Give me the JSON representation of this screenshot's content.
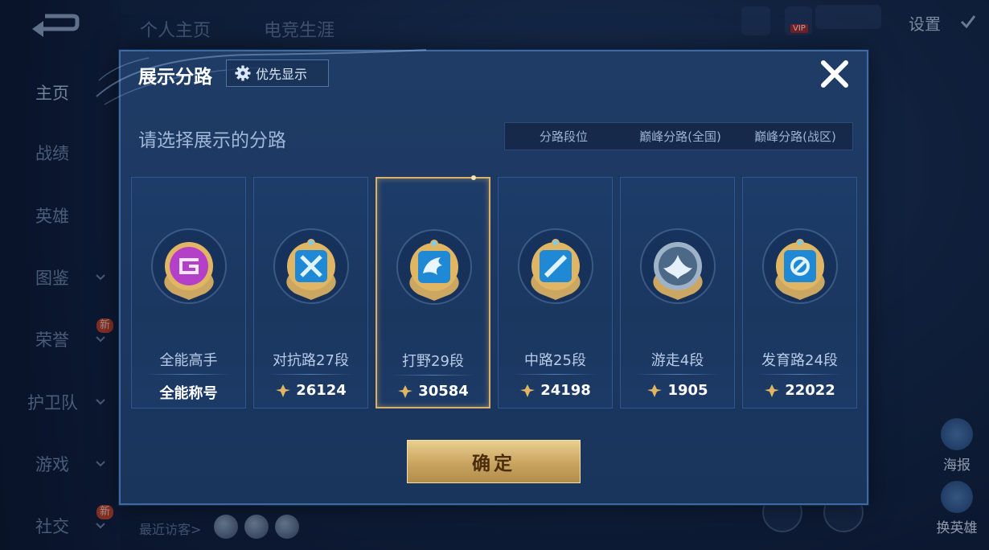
{
  "background": {
    "top_tabs": [
      "个人主页",
      "电竞生涯"
    ],
    "settings_label": "设置",
    "vip_label": "VIP",
    "sidebar": [
      {
        "label": "主页",
        "active": true,
        "chevron": false,
        "badge": ""
      },
      {
        "label": "战绩",
        "active": false,
        "chevron": false,
        "badge": ""
      },
      {
        "label": "英雄",
        "active": false,
        "chevron": false,
        "badge": ""
      },
      {
        "label": "图鉴",
        "active": false,
        "chevron": true,
        "badge": ""
      },
      {
        "label": "荣誉",
        "active": false,
        "chevron": true,
        "badge": "新"
      },
      {
        "label": "护卫队",
        "active": false,
        "chevron": true,
        "badge": ""
      },
      {
        "label": "游戏",
        "active": false,
        "chevron": true,
        "badge": ""
      },
      {
        "label": "社交",
        "active": false,
        "chevron": true,
        "badge": "新"
      }
    ],
    "recent_visitors_label": "最近访客>",
    "right_buttons": [
      "海报",
      "换英雄"
    ]
  },
  "modal": {
    "title": "展示分路",
    "priority_button": "优先显示",
    "subtitle": "请选择展示的分路",
    "segments": [
      {
        "label": "分路段位",
        "active": true
      },
      {
        "label": "巅峰分路(全国)",
        "active": false
      },
      {
        "label": "巅峰分路(战区)",
        "active": false
      }
    ],
    "cards": [
      {
        "name": "全能高手",
        "score": "全能称号",
        "has_score_icon": false,
        "emblem": "allround-emblem-icon",
        "selected": false
      },
      {
        "name": "对抗路27段",
        "score": "26124",
        "has_score_icon": true,
        "emblem": "clash-lane-emblem-icon",
        "selected": false
      },
      {
        "name": "打野29段",
        "score": "30584",
        "has_score_icon": true,
        "emblem": "jungle-emblem-icon",
        "selected": true
      },
      {
        "name": "中路25段",
        "score": "24198",
        "has_score_icon": true,
        "emblem": "mid-lane-emblem-icon",
        "selected": false
      },
      {
        "name": "游走4段",
        "score": "1905",
        "has_score_icon": true,
        "emblem": "roam-emblem-icon",
        "selected": false
      },
      {
        "name": "发育路24段",
        "score": "22022",
        "has_score_icon": true,
        "emblem": "farm-lane-emblem-icon",
        "selected": false
      }
    ],
    "confirm_button": "确定"
  },
  "colors": {
    "accent_blue": "#3a74c4",
    "selected_gold": "#d9b06a",
    "emblem_gold": "#e0b563",
    "allround_purple": "#b43fc8"
  }
}
